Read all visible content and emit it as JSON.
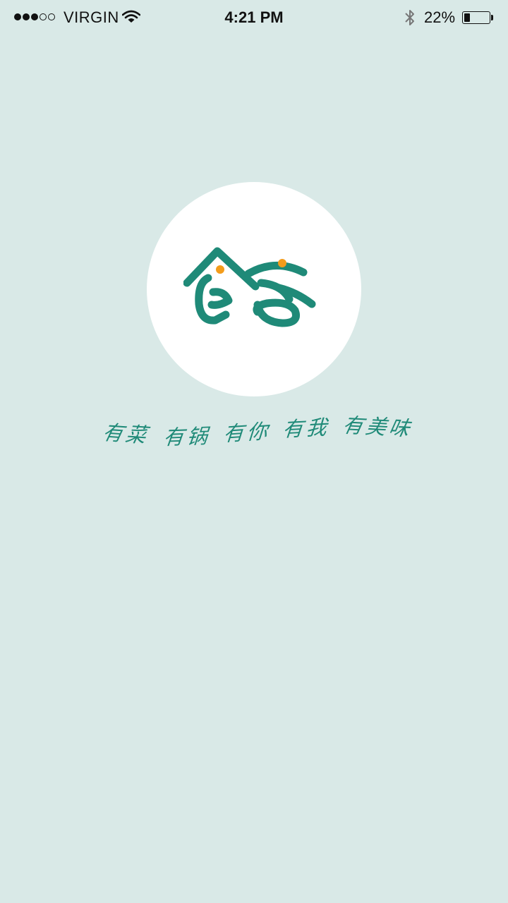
{
  "status_bar": {
    "signal_bars": 5,
    "signal_filled": 3,
    "carrier": "VIRGIN",
    "time": "4:21 PM",
    "battery_percent": "22%",
    "battery_level": 0.22,
    "icons": [
      "signal-dots",
      "wifi-icon",
      "bluetooth-icon",
      "battery-icon"
    ]
  },
  "logo": {
    "text": "食客",
    "brand_color": "#1f8a78",
    "accent_color": "#f39c1b",
    "background_color": "#ffffff"
  },
  "slogan": {
    "phrases": [
      "有菜",
      "有锅",
      "有你",
      "有我",
      "有美味"
    ]
  },
  "colors": {
    "page_background": "#d9e9e7",
    "slogan_color": "#1f8a78"
  }
}
